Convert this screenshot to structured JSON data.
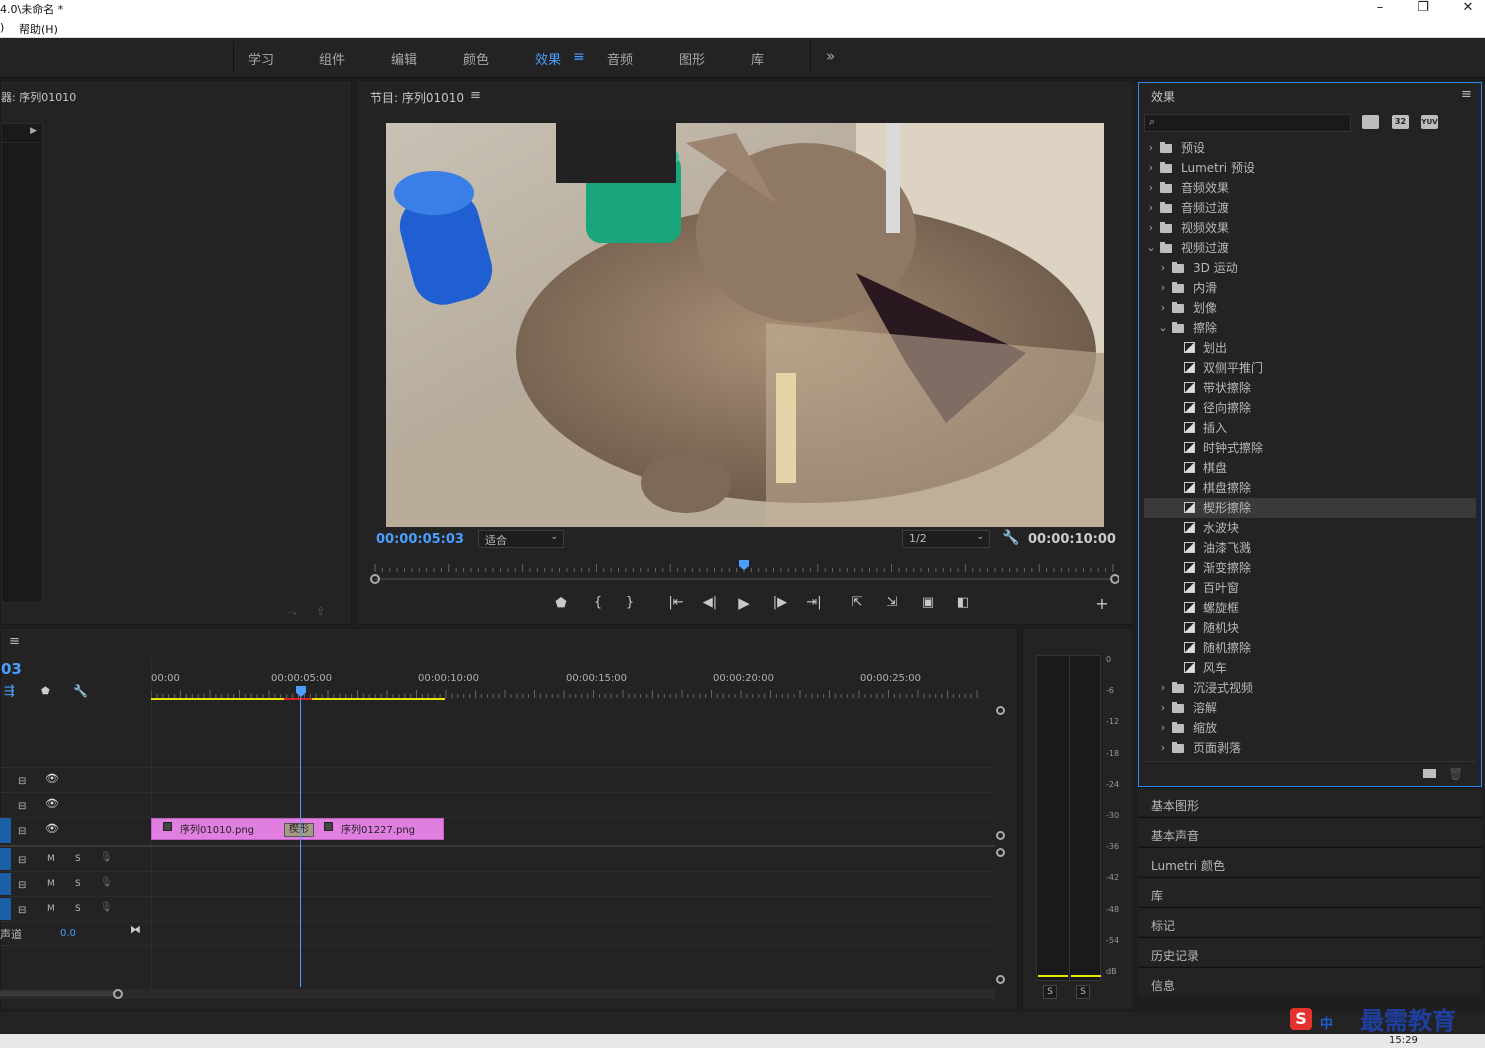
{
  "window": {
    "title": "4.0\\未命名 *",
    "minimize": "–",
    "restore": "❐",
    "close": "✕"
  },
  "menu": {
    "item1": ")",
    "help": "帮助(H)"
  },
  "workspaces": [
    {
      "label": "学习",
      "active": false
    },
    {
      "label": "组件",
      "active": false
    },
    {
      "label": "编辑",
      "active": false
    },
    {
      "label": "颜色",
      "active": false
    },
    {
      "label": "效果",
      "active": true
    },
    {
      "label": "音频",
      "active": false
    },
    {
      "label": "图形",
      "active": false
    },
    {
      "label": "库",
      "active": false
    }
  ],
  "workspace_more": "»",
  "source_panel": {
    "title": "器: 序列01010"
  },
  "program": {
    "title": "节目: 序列01010",
    "timecode": "00:00:05:03",
    "fit": "适合",
    "resolution": "1/2",
    "duration": "00:00:10:00",
    "playhead_fraction": 0.5
  },
  "effects": {
    "title": "效果",
    "search_placeholder": "",
    "badges": [
      "32",
      "YUV"
    ],
    "tree": [
      {
        "label": "预设",
        "level": 0,
        "type": "folder-star",
        "open": false
      },
      {
        "label": "Lumetri 预设",
        "level": 0,
        "type": "folder-star",
        "open": false
      },
      {
        "label": "音频效果",
        "level": 0,
        "type": "folder",
        "open": false
      },
      {
        "label": "音频过渡",
        "level": 0,
        "type": "folder",
        "open": false
      },
      {
        "label": "视频效果",
        "level": 0,
        "type": "folder",
        "open": false
      },
      {
        "label": "视频过渡",
        "level": 0,
        "type": "folder",
        "open": true
      },
      {
        "label": "3D 运动",
        "level": 1,
        "type": "folder",
        "open": false
      },
      {
        "label": "内滑",
        "level": 1,
        "type": "folder",
        "open": false
      },
      {
        "label": "划像",
        "level": 1,
        "type": "folder",
        "open": false
      },
      {
        "label": "擦除",
        "level": 1,
        "type": "folder",
        "open": true
      },
      {
        "label": "划出",
        "level": 2,
        "type": "effect"
      },
      {
        "label": "双侧平推门",
        "level": 2,
        "type": "effect"
      },
      {
        "label": "带状擦除",
        "level": 2,
        "type": "effect"
      },
      {
        "label": "径向擦除",
        "level": 2,
        "type": "effect"
      },
      {
        "label": "插入",
        "level": 2,
        "type": "effect"
      },
      {
        "label": "时钟式擦除",
        "level": 2,
        "type": "effect"
      },
      {
        "label": "棋盘",
        "level": 2,
        "type": "effect"
      },
      {
        "label": "棋盘擦除",
        "level": 2,
        "type": "effect"
      },
      {
        "label": "楔形擦除",
        "level": 2,
        "type": "effect",
        "selected": true
      },
      {
        "label": "水波块",
        "level": 2,
        "type": "effect"
      },
      {
        "label": "油漆飞溅",
        "level": 2,
        "type": "effect"
      },
      {
        "label": "渐变擦除",
        "level": 2,
        "type": "effect"
      },
      {
        "label": "百叶窗",
        "level": 2,
        "type": "effect"
      },
      {
        "label": "螺旋框",
        "level": 2,
        "type": "effect"
      },
      {
        "label": "随机块",
        "level": 2,
        "type": "effect"
      },
      {
        "label": "随机擦除",
        "level": 2,
        "type": "effect"
      },
      {
        "label": "风车",
        "level": 2,
        "type": "effect"
      },
      {
        "label": "沉浸式视频",
        "level": 1,
        "type": "folder",
        "open": false
      },
      {
        "label": "溶解",
        "level": 1,
        "type": "folder",
        "open": false
      },
      {
        "label": "缩放",
        "level": 1,
        "type": "folder",
        "open": false
      },
      {
        "label": "页面剥落",
        "level": 1,
        "type": "folder",
        "open": false
      }
    ]
  },
  "side_panels": [
    "基本图形",
    "基本声音",
    "Lumetri 颜色",
    "库",
    "标记",
    "历史记录",
    "信息"
  ],
  "timeline": {
    "timecode": "03",
    "ruler": [
      "00:00",
      "00:00:05:00",
      "00:00:10:00",
      "00:00:15:00",
      "00:00:20:00",
      "00:00:25:00"
    ],
    "clips": [
      {
        "label": "序列01010.png"
      },
      {
        "label": "序列01227.png"
      }
    ],
    "transition": "楔形",
    "audio_track_labels": {
      "m": "M",
      "s": "S"
    },
    "master_label": "声道",
    "master_value": "0.0"
  },
  "meter": {
    "labels": [
      "0",
      "-6",
      "-12",
      "-18",
      "-24",
      "-30",
      "-36",
      "-42",
      "-48",
      "-54",
      "dB"
    ],
    "solo": [
      "S",
      "S"
    ]
  },
  "taskbar": {
    "time": "15:29",
    "ime": "中",
    "watermark": "最需教育"
  },
  "colors": {
    "accent": "#2d8ceb",
    "clip": "#e07fe0",
    "playhead": "#4a9eff",
    "timeline_bar": "#e6e600"
  }
}
